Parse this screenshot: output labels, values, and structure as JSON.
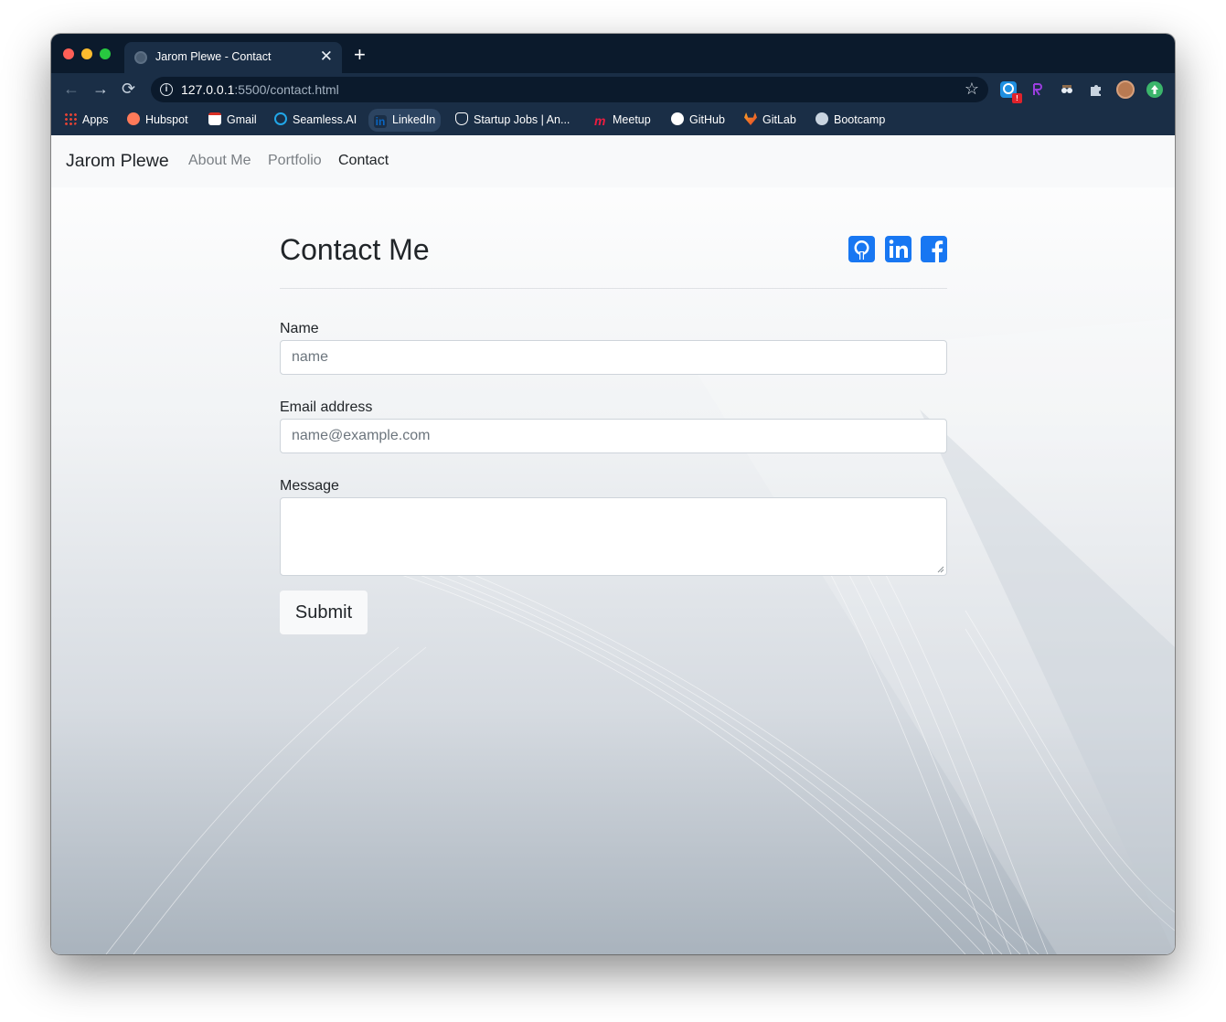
{
  "browser": {
    "tab_title": "Jarom Plewe - Contact",
    "tab_close": "✕",
    "new_tab": "+",
    "nav_back": "←",
    "nav_forward": "→",
    "nav_reload": "⟳",
    "url_host": "127.0.0.1",
    "url_path": ":5500/contact.html",
    "info_symbol": "i",
    "star": "☆",
    "extensions": [
      "extension-icon",
      "r-extension-icon",
      "spy-extension-icon",
      "puzzle-icon",
      "profile-avatar",
      "update-icon"
    ],
    "bookmarks": [
      {
        "label": "Apps",
        "icon": "apps-grid-icon"
      },
      {
        "label": "Hubspot",
        "icon": "hubspot-icon"
      },
      {
        "label": "Gmail",
        "icon": "gmail-icon"
      },
      {
        "label": "Seamless.AI",
        "icon": "seamless-icon"
      },
      {
        "label": "LinkedIn",
        "icon": "linkedin-icon"
      },
      {
        "label": "Startup Jobs | An...",
        "icon": "angellist-icon"
      },
      {
        "label": "Meetup",
        "icon": "meetup-icon"
      },
      {
        "label": "GitHub",
        "icon": "github-icon"
      },
      {
        "label": "GitLab",
        "icon": "gitlab-icon"
      },
      {
        "label": "Bootcamp",
        "icon": "globe-icon"
      }
    ]
  },
  "navbar": {
    "brand": "Jarom Plewe",
    "links": [
      "About Me",
      "Portfolio",
      "Contact"
    ]
  },
  "contact": {
    "heading": "Contact Me",
    "socials": [
      "github-icon",
      "linkedin-icon",
      "facebook-icon"
    ],
    "name_label": "Name",
    "name_placeholder": "name",
    "email_label": "Email address",
    "email_placeholder": "name@example.com",
    "message_label": "Message",
    "message_placeholder": "",
    "submit_label": "Submit"
  },
  "colors": {
    "titlebar": "#0b1a2c",
    "toolbar": "#1a2e46",
    "social_icon": "#1877f2"
  }
}
